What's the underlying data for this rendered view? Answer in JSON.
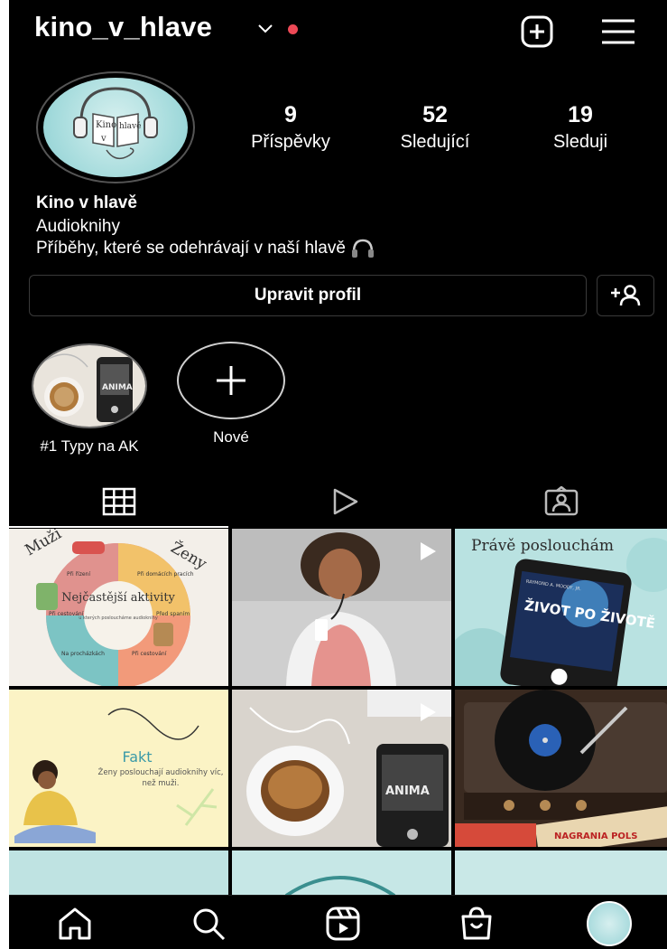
{
  "app": "Instagram",
  "header": {
    "username": "kino_v_hlave",
    "icons": [
      "chevron-down-icon",
      "notification-dot",
      "plus-square-icon",
      "hamburger-menu-icon"
    ]
  },
  "profile": {
    "avatar_text_1": "Kino",
    "avatar_text_2": "v",
    "avatar_text_3": "hlavě",
    "stats": [
      {
        "value": "9",
        "label": "Příspěvky"
      },
      {
        "value": "52",
        "label": "Sledující"
      },
      {
        "value": "19",
        "label": "Sleduji"
      }
    ],
    "name": "Kino v hlavě",
    "category": "Audioknihy",
    "bio": "Příběhy, které se odehrávají v naší hlavě",
    "bio_icon": "headphones-icon",
    "edit_label": "Upravit profil",
    "discover_icon": "add-person-icon"
  },
  "highlights": [
    {
      "label": "#1 Typy na AK"
    },
    {
      "label": "Nové"
    }
  ],
  "tabs": [
    "grid-icon",
    "reels-play-icon",
    "tagged-person-icon"
  ],
  "posts": {
    "p1_left": "Muži",
    "p1_right": "Ženy",
    "p1_center": "Nejčastější aktivity",
    "p1_center_sub": "u kterých posloucháme audioknihy",
    "p1_items": [
      "Při řízení",
      "Při domácích pracích",
      "Při cestování",
      "Před spaním",
      "Na procházkách",
      "Při cestování"
    ],
    "p3_title": "Právě poslouchám",
    "p3_author": "RAYMOND A. MOODY, JR.",
    "p3_book": "ŽIVOT PO ŽIVOTĚ",
    "p4_title": "Fakt",
    "p4_text": "Ženy poslouchají audioknihy víc, než muži.",
    "p5_book": "ANIMA",
    "p6_label": "NAGRANIA POLS"
  },
  "bottom_nav": [
    "home-icon",
    "search-icon",
    "reels-icon",
    "shop-icon",
    "profile-avatar"
  ],
  "colors": {
    "background": "#000000",
    "accent_red": "#ed4956",
    "teal": "#a9ddde"
  }
}
